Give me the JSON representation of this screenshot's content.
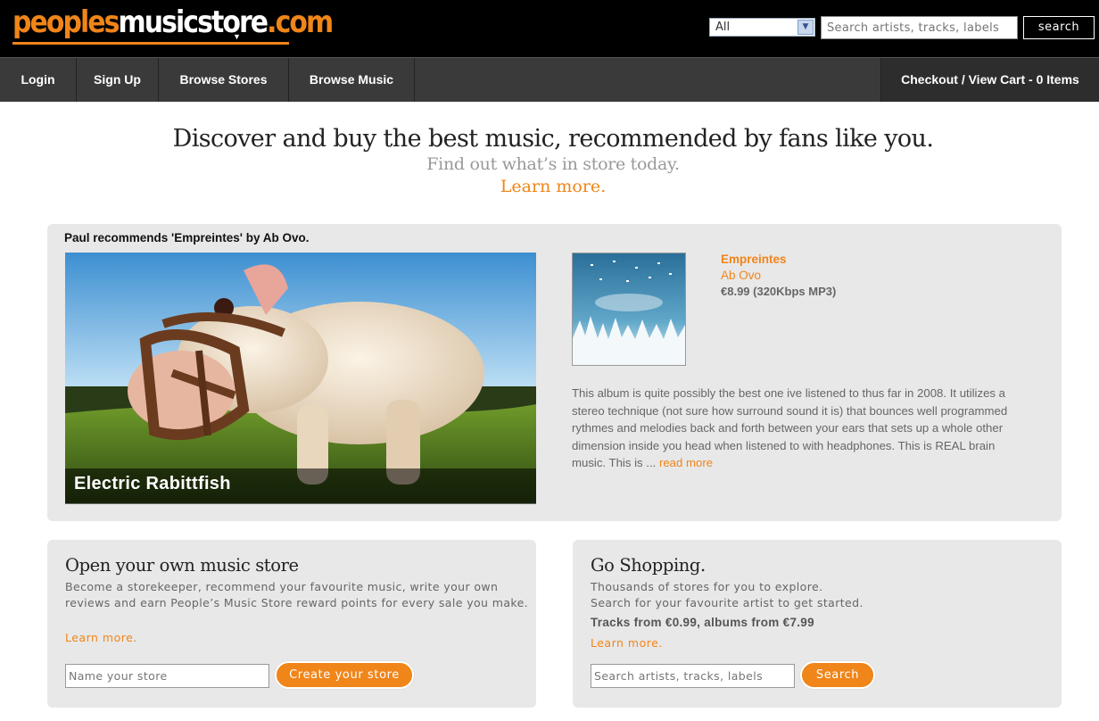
{
  "header": {
    "logo_part1": "peoples",
    "logo_part2": "music",
    "logo_part3": "store",
    "logo_part4": ".com",
    "filter_value": "All",
    "search_placeholder": "Search artists, tracks, labels",
    "search_button": "search"
  },
  "nav": {
    "items": [
      {
        "label": "Login"
      },
      {
        "label": "Sign Up"
      },
      {
        "label": "Browse Stores"
      },
      {
        "label": "Browse Music"
      }
    ],
    "cart_label": "Checkout / View Cart - 0 Items"
  },
  "hero": {
    "title": "Discover and buy the best music, recommended by fans like you.",
    "subtitle": "Find out what’s in store today.",
    "learn_more": "Learn more."
  },
  "feature": {
    "heading": "Paul recommends 'Empreintes' by Ab Ovo.",
    "image_caption": "Electric Rabittfish",
    "album": {
      "title": "Empreintes",
      "artist": "Ab Ovo",
      "price": "€8.99 (320Kbps MP3)"
    },
    "review_text": "This album is quite possibly the best one ive listened to thus far in 2008. It utilizes a stereo technique (not sure how surround sound it is) that bounces well programmed rythmes and melodies back and forth between your ears that sets up a whole other dimension inside you head when listened to with headphones. This is REAL brain music. This is ... ",
    "read_more": "read more"
  },
  "store_panel": {
    "title": "Open your own music store",
    "text": "Become a storekeeper, recommend your favourite music, write your own reviews and earn People’s Music Store reward points for every sale you make.",
    "learn_more": "Learn more.",
    "input_placeholder": "Name your store",
    "button": "Create your store"
  },
  "shop_panel": {
    "title": "Go Shopping.",
    "line1": "Thousands of stores for you to explore.",
    "line2": "Search for your favourite artist to get started.",
    "prices": "Tracks from €0.99, albums from €7.99",
    "learn_more": "Learn more.",
    "input_placeholder": "Search artists, tracks, labels",
    "button": "Search"
  },
  "colors": {
    "accent": "#f08519",
    "header_bg": "#000000",
    "nav_bg": "#3a3a3a",
    "panel_bg": "#e8e8e8"
  }
}
